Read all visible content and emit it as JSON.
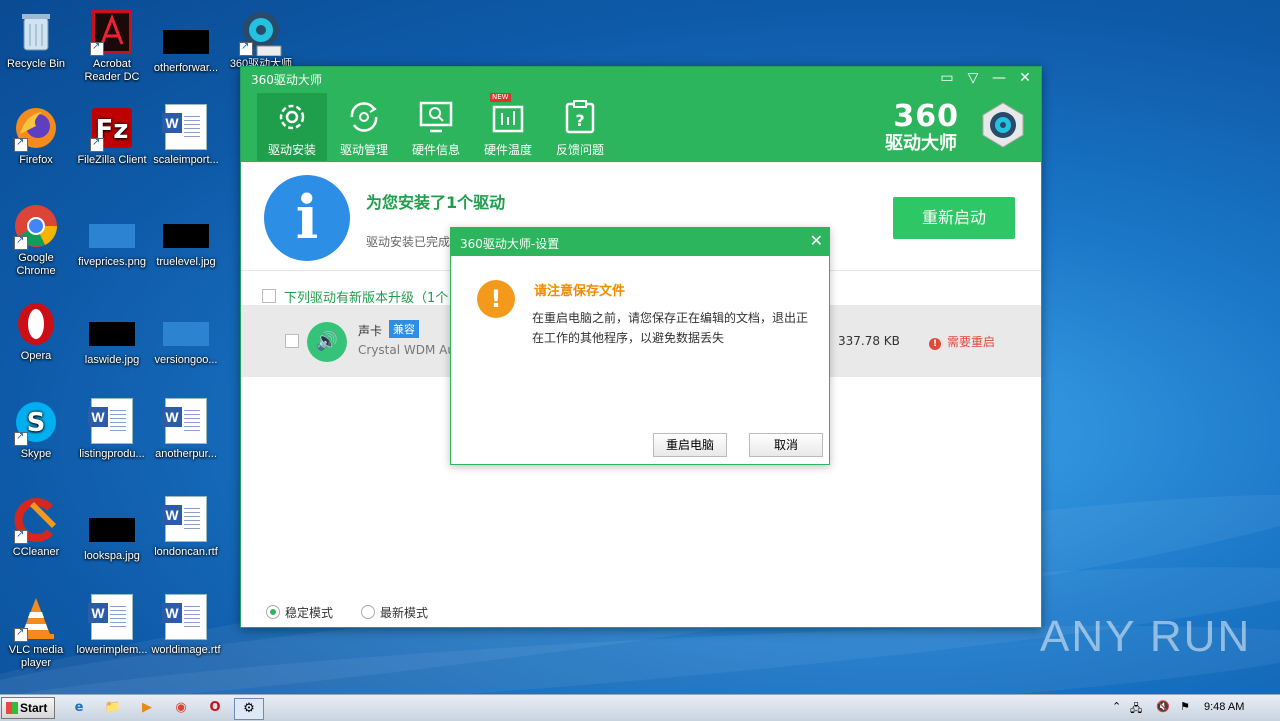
{
  "desktop": {
    "icons": [
      {
        "label": "Recycle Bin"
      },
      {
        "label": "Acrobat\nReader DC"
      },
      {
        "label": "otherforwar..."
      },
      {
        "label": "360驱动大师"
      },
      {
        "label": "Firefox"
      },
      {
        "label": "FileZilla Client"
      },
      {
        "label": "scaleimport..."
      },
      {
        "label": "Google\nChrome"
      },
      {
        "label": "fiveprices.png"
      },
      {
        "label": "truelevel.jpg"
      },
      {
        "label": "Opera"
      },
      {
        "label": "laswide.jpg"
      },
      {
        "label": "versiongoo..."
      },
      {
        "label": "Skype"
      },
      {
        "label": "listingprodu..."
      },
      {
        "label": "anotherpur..."
      },
      {
        "label": "CCleaner"
      },
      {
        "label": "lookspa.jpg"
      },
      {
        "label": "londoncan.rtf"
      },
      {
        "label": "VLC media\nplayer"
      },
      {
        "label": "lowerimplem..."
      },
      {
        "label": "worldimage.rtf"
      }
    ]
  },
  "app": {
    "title": "360驱动大师",
    "tabs": [
      {
        "label": "驱动安装"
      },
      {
        "label": "驱动管理"
      },
      {
        "label": "硬件信息"
      },
      {
        "label": "硬件温度"
      },
      {
        "label": "反馈问题"
      }
    ],
    "logo_number": "360",
    "logo_text": "驱动大师",
    "new_badge": "NEW",
    "head_message": "为您安装了1个驱动",
    "sub_message": "驱动安装已完成",
    "restart_button": "重新启动",
    "update_line": "下列驱动有新版本升级（1个",
    "driver": {
      "name": "声卡",
      "badge": "兼容",
      "subtitle": "Crystal WDM Au",
      "size": "337.78 KB",
      "status": "需要重启"
    },
    "modes": {
      "stable": "稳定模式",
      "latest": "最新模式"
    }
  },
  "dialog": {
    "title": "360驱动大师-设置",
    "warn_title": "请注意保存文件",
    "body": "在重启电脑之前，请您保存正在编辑的文档，退出正在工作的其他程序，以避免数据丢失",
    "confirm": "重启电脑",
    "cancel": "取消"
  },
  "watermark": "ANY RUN",
  "taskbar": {
    "start": "Start",
    "clock": "9:48 AM"
  },
  "colors": {
    "green": "#2db55d",
    "dark_green": "#1f9e4c",
    "blue": "#2c8ee4",
    "orange": "#f39a1d",
    "red": "#e04a3a"
  }
}
